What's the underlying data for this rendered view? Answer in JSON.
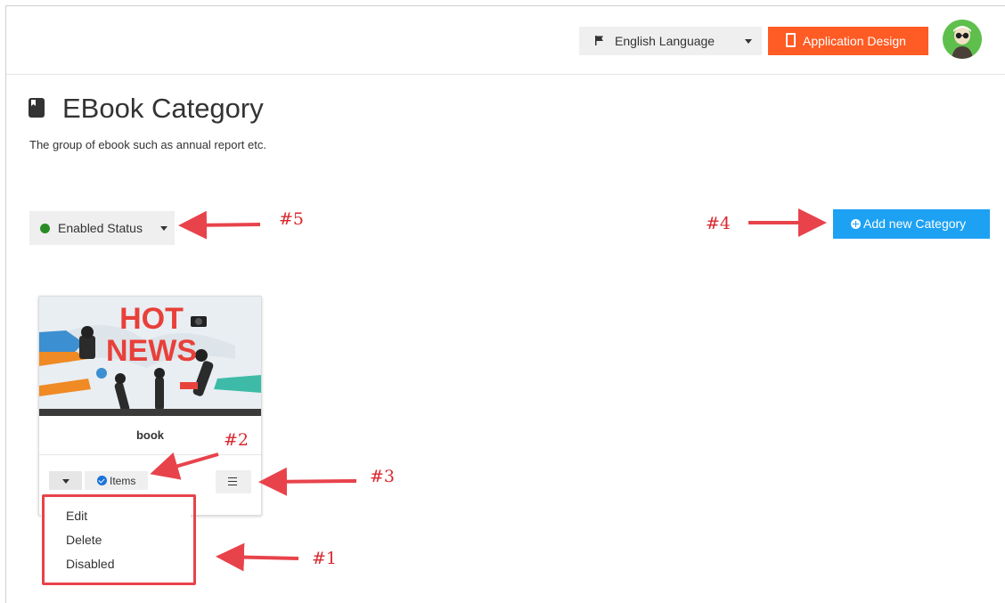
{
  "header": {
    "language_label": "English Language",
    "design_button_label": "Application Design"
  },
  "page": {
    "title": "EBook Category",
    "subtitle": "The group of ebook such as annual report etc."
  },
  "toolbar": {
    "status_filter_label": "Enabled Status",
    "add_button_label": "Add new Category"
  },
  "card": {
    "image_text_line1": "HOT",
    "image_text_line2": "NEWS",
    "name": "book",
    "items_label": "Items"
  },
  "dropdown": {
    "items": [
      "Edit",
      "Delete",
      "Disabled"
    ]
  },
  "annotations": [
    "#1",
    "#2",
    "#3",
    "#4",
    "#5"
  ],
  "colors": {
    "accent_orange": "#ff5b24",
    "accent_blue": "#1da1f2",
    "status_green": "#2a8b24",
    "annotation_red": "#d9282f"
  }
}
